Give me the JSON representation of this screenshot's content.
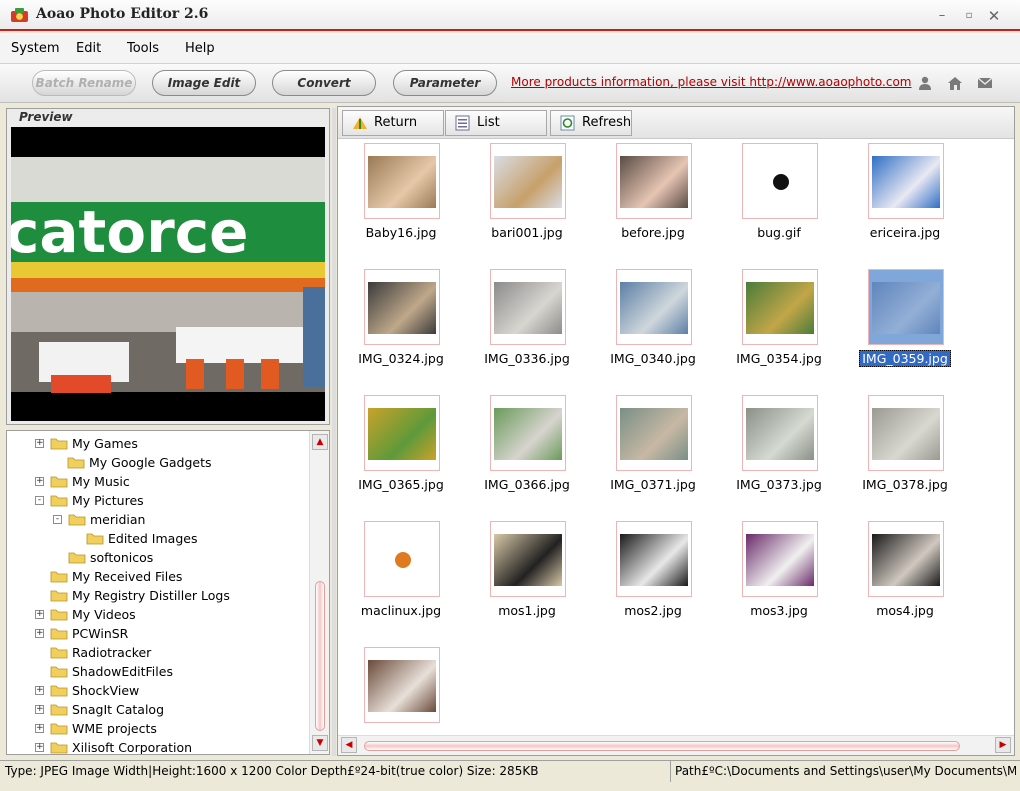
{
  "window": {
    "title": "Aoao Photo Editor 2.6"
  },
  "menu": [
    "System",
    "Edit",
    "Tools",
    "Help"
  ],
  "toolbar": {
    "batch_rename": "Batch Rename",
    "image_edit": "Image Edit",
    "convert": "Convert",
    "parameter": "Parameter",
    "promo_link": "More products information, please visit http://www.aoaophoto.com",
    "icons": [
      "user-icon",
      "home-icon",
      "mail-icon"
    ]
  },
  "preview": {
    "label": "Preview",
    "sign_text": "catorce"
  },
  "tree": [
    {
      "label": "My Games",
      "expander": "+"
    },
    {
      "label": "My Google Gadgets",
      "expander": ""
    },
    {
      "label": "My Music",
      "expander": "+"
    },
    {
      "label": "My Pictures",
      "expander": "-"
    },
    {
      "label": "meridian",
      "expander": "-"
    },
    {
      "label": "Edited Images",
      "expander": ""
    },
    {
      "label": "softonicos",
      "expander": ""
    },
    {
      "label": "My Received Files",
      "expander": ""
    },
    {
      "label": "My Registry Distiller Logs",
      "expander": ""
    },
    {
      "label": "My Videos",
      "expander": "+"
    },
    {
      "label": "PCWinSR",
      "expander": "+"
    },
    {
      "label": "Radiotracker",
      "expander": ""
    },
    {
      "label": "ShadowEditFiles",
      "expander": ""
    },
    {
      "label": "ShockView",
      "expander": "+"
    },
    {
      "label": "SnagIt Catalog",
      "expander": "+"
    },
    {
      "label": "WME projects",
      "expander": "+"
    },
    {
      "label": "Xilisoft Corporation",
      "expander": "+"
    }
  ],
  "files_toolbar": {
    "return": "Return",
    "list": "List",
    "refresh": "Refresh"
  },
  "files": [
    "Baby16.jpg",
    "bari001.jpg",
    "before.jpg",
    "bug.gif",
    "ericeira.jpg",
    "IMG_0324.jpg",
    "IMG_0336.jpg",
    "IMG_0340.jpg",
    "IMG_0354.jpg",
    "IMG_0359.jpg",
    "IMG_0365.jpg",
    "IMG_0366.jpg",
    "IMG_0371.jpg",
    "IMG_0373.jpg",
    "IMG_0378.jpg",
    "maclinux.jpg",
    "mos1.jpg",
    "mos2.jpg",
    "mos3.jpg",
    "mos4.jpg",
    ""
  ],
  "selected_file": "IMG_0359.jpg",
  "status": {
    "info": "Type: JPEG Image  Width|Height:1600 x 1200  Color Depth£º24-bit(true color)    Size: 285KB",
    "path": "Path£ºC:\\Documents and Settings\\user\\My Documents\\My Pictures\\meridian"
  },
  "colors": {
    "accent_red": "#c21f1f",
    "selection_blue": "#316ac5",
    "thumb_border": "#f0b4b4"
  }
}
